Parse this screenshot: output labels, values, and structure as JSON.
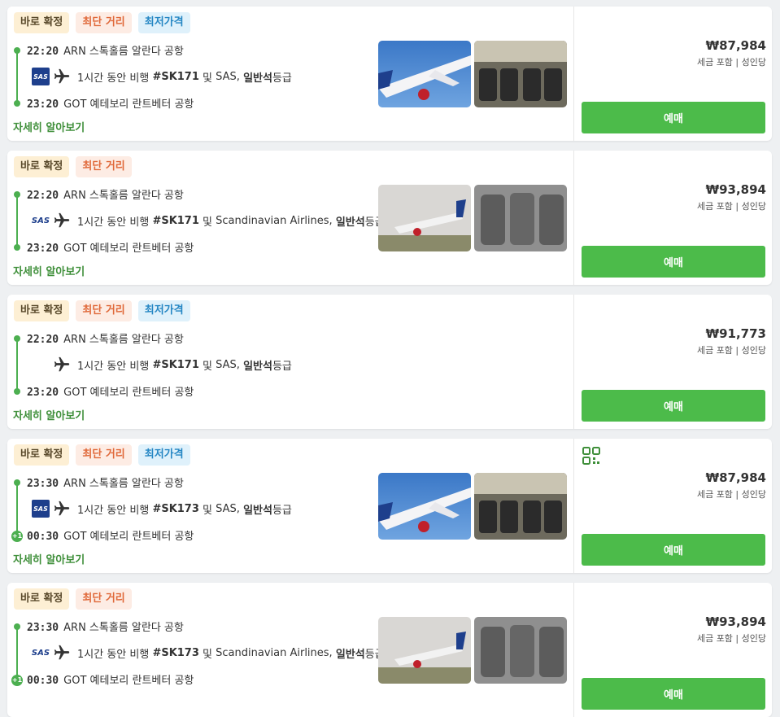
{
  "cards": [
    {
      "tags": [
        "바로 확정",
        "최단 거리",
        "최저가격"
      ],
      "dep_time": "22:20",
      "dep_airport": "ARN 스톡홀름 알란다 공항",
      "duration": "1시간 동안 비행",
      "flight_no": "#SK171",
      "conj": "및",
      "airline": "SAS,",
      "cabin": "일반석",
      "cabin_suffix": "등급",
      "arr_time": "23:20",
      "arr_airport": "GOT 예테보리 란트베터 공항",
      "details": "자세히 알아보기",
      "price": "₩87,984",
      "price_note": "세금 포함 | 성인당",
      "book": "예매",
      "logo": "SAS"
    },
    {
      "tags": [
        "바로 확정",
        "최단 거리"
      ],
      "dep_time": "22:20",
      "dep_airport": "ARN 스톡홀름 알란다 공항",
      "duration": "1시간 동안 비행",
      "flight_no": "#SK171",
      "conj": "및",
      "airline": "Scandinavian Airlines,",
      "cabin": "일반석",
      "cabin_suffix": "등급",
      "arr_time": "23:20",
      "arr_airport": "GOT 예테보리 란트베터 공항",
      "details": "자세히 알아보기",
      "price": "₩93,894",
      "price_note": "세금 포함 | 성인당",
      "book": "예매",
      "logo": "SAS"
    },
    {
      "tags": [
        "바로 확정",
        "최단 거리",
        "최저가격"
      ],
      "dep_time": "22:20",
      "dep_airport": "ARN 스톡홀름 알란다 공항",
      "duration": "1시간 동안 비행",
      "flight_no": "#SK171",
      "conj": "및",
      "airline": "SAS,",
      "cabin": "일반석",
      "cabin_suffix": "등급",
      "arr_time": "23:20",
      "arr_airport": "GOT 예테보리 란트베터 공항",
      "details": "자세히 알아보기",
      "price": "₩91,773",
      "price_note": "세금 포함 | 성인당",
      "book": "예매",
      "logo": ""
    },
    {
      "tags": [
        "바로 확정",
        "최단 거리",
        "최저가격"
      ],
      "dep_time": "23:30",
      "dep_airport": "ARN 스톡홀름 알란다 공항",
      "duration": "1시간 동안 비행",
      "flight_no": "#SK173",
      "conj": "및",
      "airline": "SAS,",
      "cabin": "일반석",
      "cabin_suffix": "등급",
      "arr_time": "00:30",
      "arr_airport": "GOT 예테보리 란트베터 공항",
      "next_day": "+1",
      "details": "자세히 알아보기",
      "price": "₩87,984",
      "price_note": "세금 포함 | 성인당",
      "book": "예매",
      "logo": "SAS"
    },
    {
      "tags": [
        "바로 확정",
        "최단 거리"
      ],
      "dep_time": "23:30",
      "dep_airport": "ARN 스톡홀름 알란다 공항",
      "duration": "1시간 동안 비행",
      "flight_no": "#SK173",
      "conj": "및",
      "airline": "Scandinavian Airlines,",
      "cabin": "일반석",
      "cabin_suffix": "등급",
      "arr_time": "00:30",
      "arr_airport": "GOT 예테보리 란트베터 공항",
      "next_day": "+1",
      "details": "자세히 알아보기",
      "price": "₩93,894",
      "price_note": "세금 포함 | 성인당",
      "book": "예매",
      "logo": "SAS"
    }
  ],
  "colors": {
    "accent_green": "#4cbb4a",
    "timeline_green": "#4caf50",
    "sas_blue": "#1e3f8c"
  }
}
